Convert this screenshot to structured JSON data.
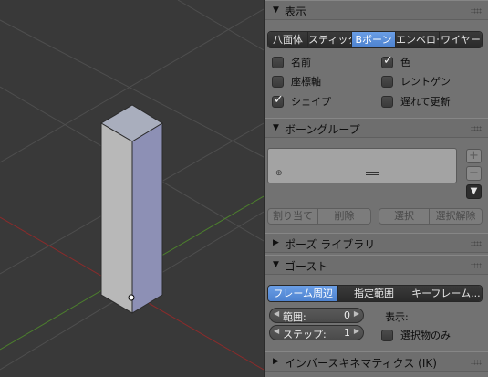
{
  "panel": {
    "display": {
      "title": "表示",
      "draw_types": [
        "八面体",
        "スティック",
        "Bボーン",
        "エンベロープ",
        "ワイヤー"
      ],
      "draw_type_selected": "Bボーン",
      "options": [
        {
          "label": "名前",
          "checked": false
        },
        {
          "label": "色",
          "checked": true
        },
        {
          "label": "座標軸",
          "checked": false
        },
        {
          "label": "レントゲン",
          "checked": false
        },
        {
          "label": "シェイプ",
          "checked": true
        },
        {
          "label": "遅れて更新",
          "checked": false
        }
      ]
    },
    "bone_groups": {
      "title": "ボーングループ",
      "add_icon": "plus-icon",
      "remove_icon": "minus-icon",
      "menu_icon": "dropdown-arrow-icon",
      "assign_label": "割り当て",
      "remove_label": "削除",
      "select_label": "選択",
      "deselect_label": "選択解除"
    },
    "pose_library": {
      "title": "ポーズ ライブラリ"
    },
    "ghost": {
      "title": "ゴースト",
      "modes": [
        "フレーム周辺",
        "指定範囲",
        "キーフレーム..."
      ],
      "mode_selected": "フレーム周辺",
      "range_label": "範囲:",
      "range_value": "0",
      "step_label": "ステップ:",
      "step_value": "1",
      "display_label": "表示:",
      "selected_only_label": "選択物のみ",
      "selected_only_checked": false
    },
    "ik": {
      "title": "インバースキネマティクス (IK)"
    }
  },
  "colors": {
    "viewport_bg": "#393939",
    "panel_bg": "#727272",
    "accent": "#5a8fde",
    "x_axis": "#8b2b2b",
    "y_axis": "#4c7f2d"
  }
}
